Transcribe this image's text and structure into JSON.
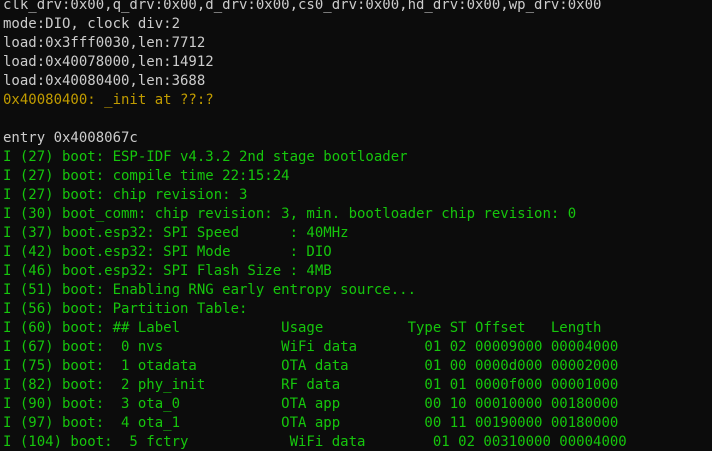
{
  "colors": {
    "background": "#0c0c0c",
    "default_text": "#cccccc",
    "info_text": "#16c60c",
    "warning_text": "#c19c00"
  },
  "terminal": {
    "lines": [
      {
        "text": "clk_drv:0x00,q_drv:0x00,d_drv:0x00,cs0_drv:0x00,hd_drv:0x00,wp_drv:0x00",
        "color": "white"
      },
      {
        "text": "mode:DIO, clock div:2",
        "color": "white"
      },
      {
        "text": "load:0x3fff0030,len:7712",
        "color": "white"
      },
      {
        "text": "load:0x40078000,len:14912",
        "color": "white"
      },
      {
        "text": "load:0x40080400,len:3688",
        "color": "white"
      },
      {
        "text": "0x40080400: _init at ??:?",
        "color": "yellow"
      },
      {
        "text": "",
        "color": "white"
      },
      {
        "text": "entry 0x4008067c",
        "color": "white"
      },
      {
        "text": "I (27) boot: ESP-IDF v4.3.2 2nd stage bootloader",
        "color": "green"
      },
      {
        "text": "I (27) boot: compile time 22:15:24",
        "color": "green"
      },
      {
        "text": "I (27) boot: chip revision: 3",
        "color": "green"
      },
      {
        "text": "I (30) boot_comm: chip revision: 3, min. bootloader chip revision: 0",
        "color": "green"
      },
      {
        "text": "I (37) boot.esp32: SPI Speed      : 40MHz",
        "color": "green"
      },
      {
        "text": "I (42) boot.esp32: SPI Mode       : DIO",
        "color": "green"
      },
      {
        "text": "I (46) boot.esp32: SPI Flash Size : 4MB",
        "color": "green"
      },
      {
        "text": "I (51) boot: Enabling RNG early entropy source...",
        "color": "green"
      },
      {
        "text": "I (56) boot: Partition Table:",
        "color": "green"
      },
      {
        "text": "I (60) boot: ## Label            Usage          Type ST Offset   Length",
        "color": "green"
      },
      {
        "text": "I (67) boot:  0 nvs              WiFi data        01 02 00009000 00004000",
        "color": "green"
      },
      {
        "text": "I (75) boot:  1 otadata          OTA data         01 00 0000d000 00002000",
        "color": "green"
      },
      {
        "text": "I (82) boot:  2 phy_init         RF data          01 01 0000f000 00001000",
        "color": "green"
      },
      {
        "text": "I (90) boot:  3 ota_0            OTA app          00 10 00010000 00180000",
        "color": "green"
      },
      {
        "text": "I (97) boot:  4 ota_1            OTA app          00 11 00190000 00180000",
        "color": "green"
      },
      {
        "text": "I (104) boot:  5 fctry            WiFi data        01 02 00310000 00004000",
        "color": "green"
      }
    ]
  }
}
